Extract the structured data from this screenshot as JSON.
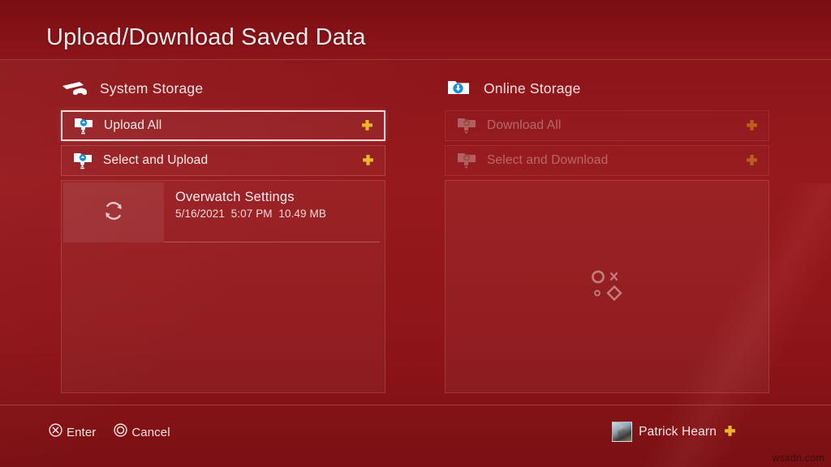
{
  "header": {
    "title": "Upload/Download Saved Data"
  },
  "colors": {
    "background_top": "#7d0f15",
    "background_mid": "#96191d",
    "background_bottom": "#7b1014",
    "text": "#f3e4e4",
    "ps_plus_gold": "#e8b828",
    "icon_blue": "#1b8fd4",
    "icon_white": "#ffffff",
    "selection_border": "#ffebeb"
  },
  "columns": {
    "left": {
      "header_label": "System Storage",
      "header_icon": "ps4-console-icon",
      "actions": [
        {
          "label": "Upload All",
          "icon": "folder-upload-icon",
          "badge": "ps-plus-icon",
          "selected": true,
          "disabled": false
        },
        {
          "label": "Select and Upload",
          "icon": "folder-upload-icon",
          "badge": "ps-plus-icon",
          "selected": false,
          "disabled": false
        }
      ],
      "save_items": [
        {
          "title": "Overwatch Settings",
          "date": "5/16/2021",
          "time": "5:07 PM",
          "size": "10.49 MB",
          "thumb_icon": "sync-icon"
        }
      ],
      "empty": false
    },
    "right": {
      "header_label": "Online Storage",
      "header_icon": "cloud-folder-download-icon",
      "actions": [
        {
          "label": "Download All",
          "icon": "folder-download-icon",
          "badge": "ps-plus-icon",
          "selected": false,
          "disabled": true
        },
        {
          "label": "Select and Download",
          "icon": "folder-download-icon",
          "badge": "ps-plus-icon",
          "selected": false,
          "disabled": true
        }
      ],
      "save_items": [],
      "empty": true,
      "empty_icon": "playstation-face-buttons-icon"
    }
  },
  "footer": {
    "hints": [
      {
        "button": "cross-button-icon",
        "label": "Enter"
      },
      {
        "button": "circle-button-icon",
        "label": "Cancel"
      }
    ],
    "user": {
      "name": "Patrick Hearn",
      "avatar": "user-avatar",
      "badge": "ps-plus-icon"
    }
  },
  "watermark": "wsxdn.com"
}
